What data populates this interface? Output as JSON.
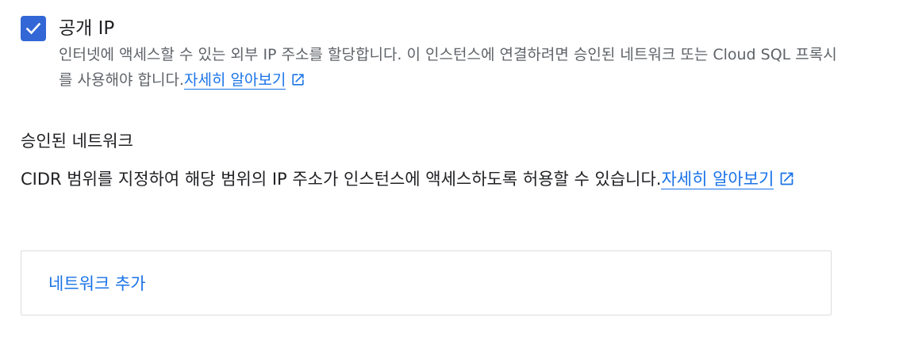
{
  "public_ip": {
    "checked": true,
    "label": "공개 IP",
    "description": "인터넷에 액세스할 수 있는 외부 IP 주소를 할당합니다. 이 인스턴스에 연결하려면 승인된 네트워크 또는 Cloud SQL 프록시를 사용해야 합니다.",
    "learn_more": "자세히 알아보기"
  },
  "authorized_networks": {
    "title": "승인된 네트워크",
    "description": "CIDR 범위를 지정하여 해당 범위의 IP 주소가 인스턴스에 액세스하도록 허용할 수 있습니다.",
    "learn_more": "자세히 알아보기",
    "add_button": "네트워크 추가"
  },
  "colors": {
    "accent": "#1a73e8",
    "checkbox": "#3367d6",
    "text": "#202124",
    "secondary_text": "#5f6368",
    "border": "#dadce0"
  }
}
